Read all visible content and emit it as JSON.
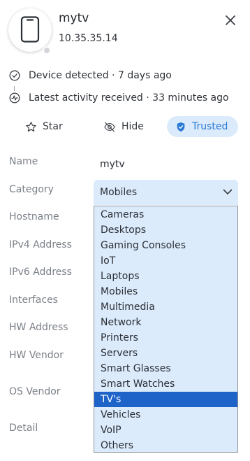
{
  "device": {
    "name": "mytv",
    "ip": "10.35.35.14",
    "icon": "phone-icon"
  },
  "timeline": [
    {
      "text": "Device detected · 7 days ago",
      "icon": "check-circle-icon"
    },
    {
      "text": "Latest activity received · 33 minutes ago",
      "icon": "activity-icon"
    }
  ],
  "actions": {
    "star": "Star",
    "hide": "Hide",
    "trusted": "Trusted"
  },
  "fields": {
    "name_label": "Name",
    "name_value": "mytv",
    "category_label": "Category",
    "category_value": "Mobiles",
    "hostname_label": "Hostname",
    "ipv4_label": "IPv4 Address",
    "ipv6_label": "IPv6 Address",
    "interfaces_label": "Interfaces",
    "hw_address_label": "HW Address",
    "hw_vendor_label": "HW Vendor",
    "os_vendor_label": "OS Vendor",
    "detail_label": "Detail"
  },
  "category_options": [
    "Cameras",
    "Desktops",
    "Gaming Consoles",
    "IoT",
    "Laptops",
    "Mobiles",
    "Multimedia",
    "Network",
    "Printers",
    "Servers",
    "Smart Glasses",
    "Smart Watches",
    "TV's",
    "Vehicles",
    "VoIP",
    "Others"
  ],
  "highlighted_option": "TV's",
  "colors": {
    "accent": "#2b7bd6",
    "select_bg": "#dcebfb",
    "highlight": "#1d63c8"
  }
}
